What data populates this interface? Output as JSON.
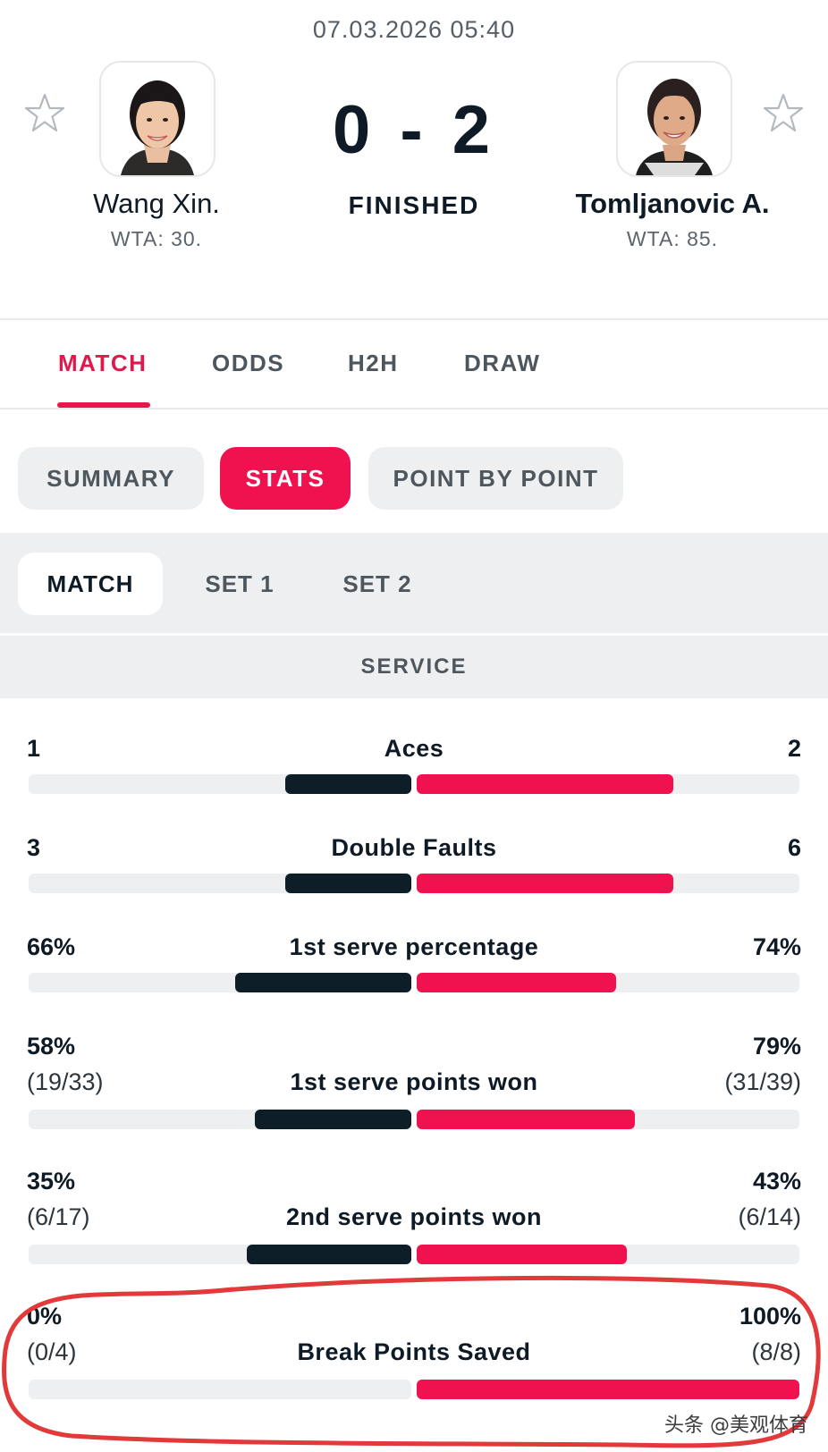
{
  "match": {
    "datetime": "07.03.2026 05:40",
    "score": "0 - 2",
    "status": "FINISHED"
  },
  "players": [
    {
      "name": "Wang Xin.",
      "rank": "WTA: 30."
    },
    {
      "name": "Tomljanovic A.",
      "rank": "WTA: 85."
    }
  ],
  "icons": {
    "favorite": "star-outline-icon"
  },
  "tabs": [
    {
      "label": "MATCH",
      "active": true
    },
    {
      "label": "ODDS",
      "active": false
    },
    {
      "label": "H2H",
      "active": false
    },
    {
      "label": "DRAW",
      "active": false
    }
  ],
  "view_pills": [
    {
      "label": "SUMMARY",
      "active": false
    },
    {
      "label": "STATS",
      "active": true
    },
    {
      "label": "POINT BY POINT",
      "active": false
    }
  ],
  "period_pills": [
    {
      "label": "MATCH",
      "active": true
    },
    {
      "label": "SET 1",
      "active": false
    },
    {
      "label": "SET 2",
      "active": false
    }
  ],
  "section_title": "SERVICE",
  "stats": [
    {
      "label": "Aces",
      "left": "1",
      "right": "2",
      "left_detail": "",
      "right_detail": "",
      "left_fill": 0.33,
      "right_fill": 0.67
    },
    {
      "label": "Double Faults",
      "left": "3",
      "right": "6",
      "left_detail": "",
      "right_detail": "",
      "left_fill": 0.33,
      "right_fill": 0.67
    },
    {
      "label": "1st serve percentage",
      "left": "66%",
      "right": "74%",
      "left_detail": "",
      "right_detail": "",
      "left_fill": 0.46,
      "right_fill": 0.52
    },
    {
      "label": "1st serve points won",
      "left": "58%",
      "right": "79%",
      "left_detail": "(19/33)",
      "right_detail": "(31/39)",
      "left_fill": 0.41,
      "right_fill": 0.57
    },
    {
      "label": "2nd serve points won",
      "left": "35%",
      "right": "43%",
      "left_detail": "(6/17)",
      "right_detail": "(6/14)",
      "left_fill": 0.43,
      "right_fill": 0.55
    },
    {
      "label": "Break Points Saved",
      "left": "0%",
      "right": "100%",
      "left_detail": "(0/4)",
      "right_detail": "(8/8)",
      "left_fill": 0.0,
      "right_fill": 1.0
    }
  ],
  "colors": {
    "accent": "#f0124f",
    "left_bar": "#0e1e29",
    "track": "#eeeff1",
    "annotation": "#e23a3a"
  },
  "watermark": "头条 @美观体育"
}
